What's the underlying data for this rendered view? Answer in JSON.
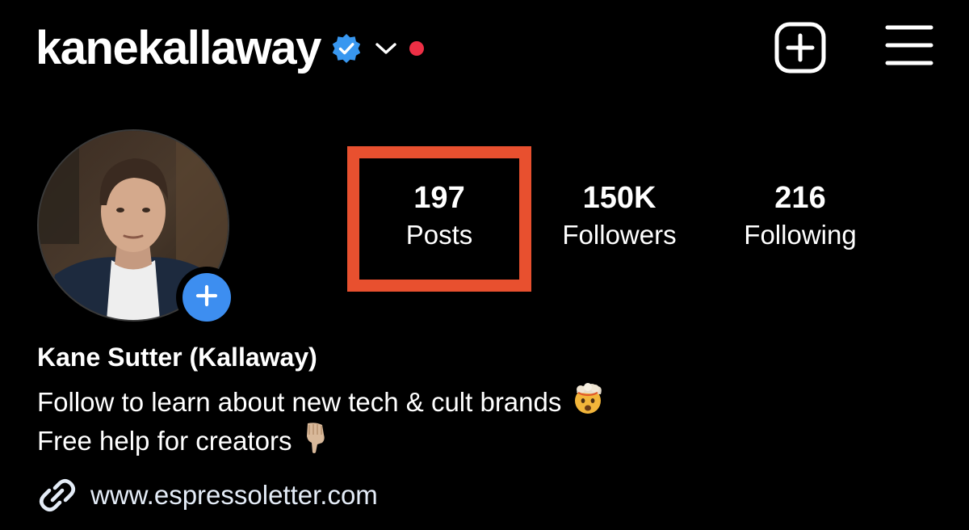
{
  "header": {
    "username": "kanekallaway",
    "icons": {
      "verified": "verified-badge-icon",
      "account_switcher": "chevron-down-icon",
      "notification_dot": "notification-dot-icon",
      "new_post": "plus-square-icon",
      "menu": "hamburger-menu-icon"
    }
  },
  "profile": {
    "avatar": "profile-photo",
    "add_story_icon": "plus-icon"
  },
  "stats": {
    "posts": {
      "count": "197",
      "label": "Posts"
    },
    "followers": {
      "count": "150K",
      "label": "Followers"
    },
    "following": {
      "count": "216",
      "label": "Following"
    }
  },
  "bio": {
    "name": "Kane Sutter (Kallaway)",
    "line1": "Follow to learn about new tech & cult brands",
    "line1_emoji": "exploding-head-emoji",
    "line2": "Free help for creators",
    "line2_emoji": "pointing-down-emoji"
  },
  "link": {
    "icon": "link-icon",
    "url": "www.espressoletter.com"
  },
  "colors": {
    "background": "#000000",
    "text": "#ffffff",
    "verified_blue": "#3897f0",
    "add_story_blue": "#3d8ef0",
    "notification_red": "#ed2f45",
    "highlight_border": "#e8502f",
    "link_text": "#e4ecf7"
  }
}
